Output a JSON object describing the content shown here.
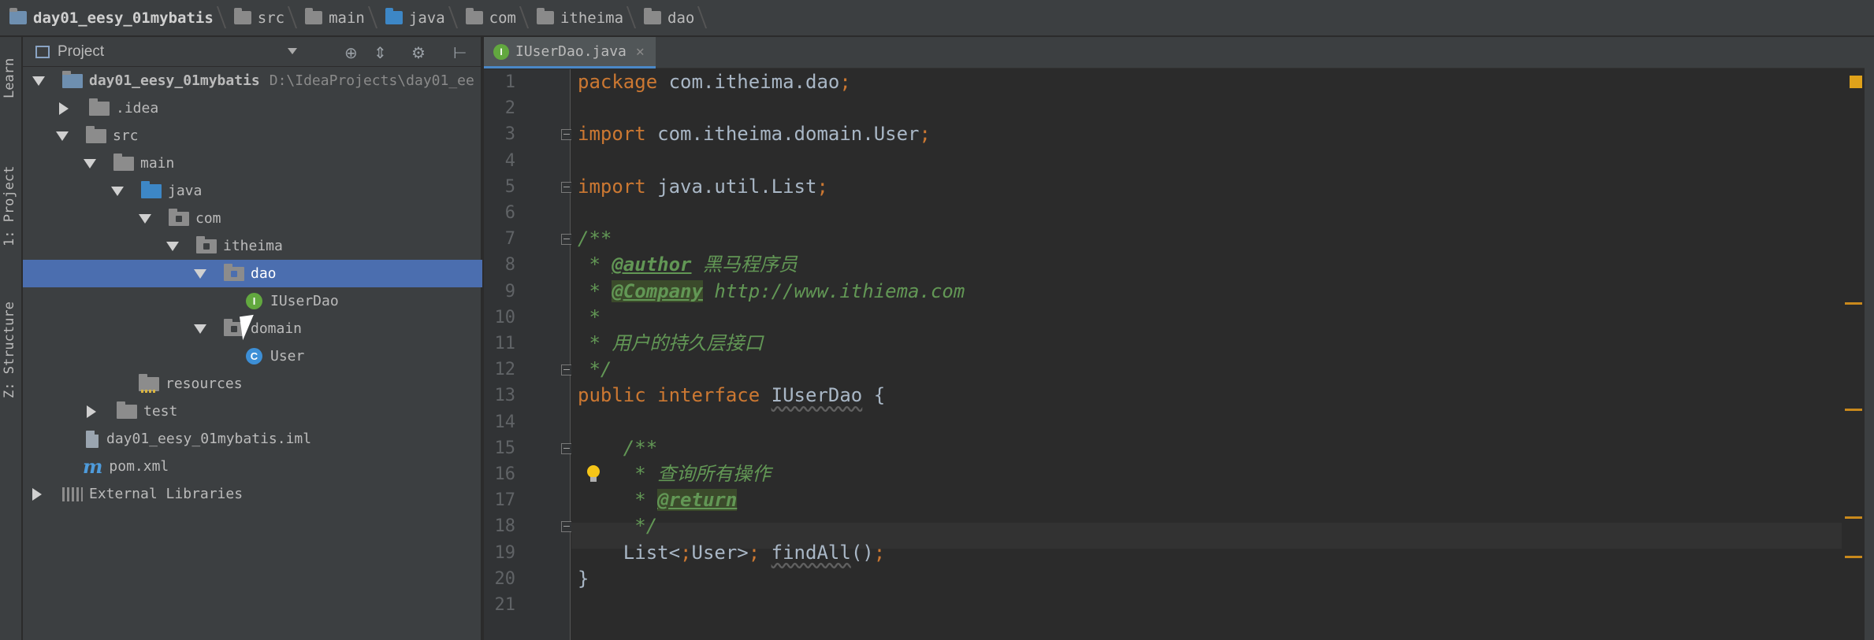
{
  "breadcrumb": {
    "items": [
      {
        "label": "day01_eesy_01mybatis",
        "icon": "module-folder-icon"
      },
      {
        "label": "src",
        "icon": "folder-icon"
      },
      {
        "label": "main",
        "icon": "folder-icon"
      },
      {
        "label": "java",
        "icon": "source-folder-icon"
      },
      {
        "label": "com",
        "icon": "package-icon"
      },
      {
        "label": "itheima",
        "icon": "package-icon"
      },
      {
        "label": "dao",
        "icon": "package-icon"
      }
    ]
  },
  "side_tabs": {
    "learn": "Learn",
    "project": "1: Project",
    "structure": "Z: Structure"
  },
  "project_panel": {
    "title": "Project",
    "tree": [
      {
        "label": "day01_eesy_01mybatis",
        "hint": "D:\\IdeaProjects\\day01_ee",
        "icon": "module-folder-icon",
        "expanded": true
      },
      {
        "label": ".idea",
        "icon": "folder-icon",
        "expanded": false
      },
      {
        "label": "src",
        "icon": "folder-icon",
        "expanded": true
      },
      {
        "label": "main",
        "icon": "folder-icon",
        "expanded": true
      },
      {
        "label": "java",
        "icon": "source-folder-icon",
        "expanded": true
      },
      {
        "label": "com",
        "icon": "package-icon",
        "expanded": true
      },
      {
        "label": "itheima",
        "icon": "package-icon",
        "expanded": true
      },
      {
        "label": "dao",
        "icon": "package-icon",
        "expanded": true,
        "selected": true
      },
      {
        "label": "IUserDao",
        "icon": "interface-icon"
      },
      {
        "label": "domain",
        "icon": "package-icon",
        "expanded": true
      },
      {
        "label": "User",
        "icon": "class-icon"
      },
      {
        "label": "resources",
        "icon": "resources-folder-icon"
      },
      {
        "label": "test",
        "icon": "folder-icon",
        "expanded": false
      },
      {
        "label": "day01_eesy_01mybatis.iml",
        "icon": "iml-file-icon"
      },
      {
        "label": "pom.xml",
        "icon": "maven-icon"
      },
      {
        "label": "External Libraries",
        "icon": "libraries-icon",
        "expanded": false
      }
    ]
  },
  "editor": {
    "tab_label": "IUserDao.java",
    "lines": [
      "package com.itheima.dao;",
      "",
      "import com.itheima.domain.User;",
      "",
      "import java.util.List;",
      "",
      "/**",
      " * @author 黑马程序员",
      " * @Company http://www.ithiema.com",
      " *",
      " * 用户的持久层接口",
      " */",
      "public interface IUserDao {",
      "",
      "    /**",
      "     * 查询所有操作",
      "     * @return",
      "     */",
      "    List<User> findAll();",
      "}",
      ""
    ],
    "line_numbers": [
      "1",
      "2",
      "3",
      "4",
      "5",
      "6",
      "7",
      "8",
      "9",
      "10",
      "11",
      "12",
      "13",
      "14",
      "15",
      "16",
      "17",
      "18",
      "19",
      "20",
      "21"
    ]
  },
  "colors": {
    "selection": "#4b6eaf",
    "keyword": "#cc7832",
    "comment": "#629755",
    "text": "#a9b7c6",
    "interface_icon": "#62a83f",
    "class_icon": "#3d8fd6",
    "warning_marker": "#e0a21a"
  }
}
